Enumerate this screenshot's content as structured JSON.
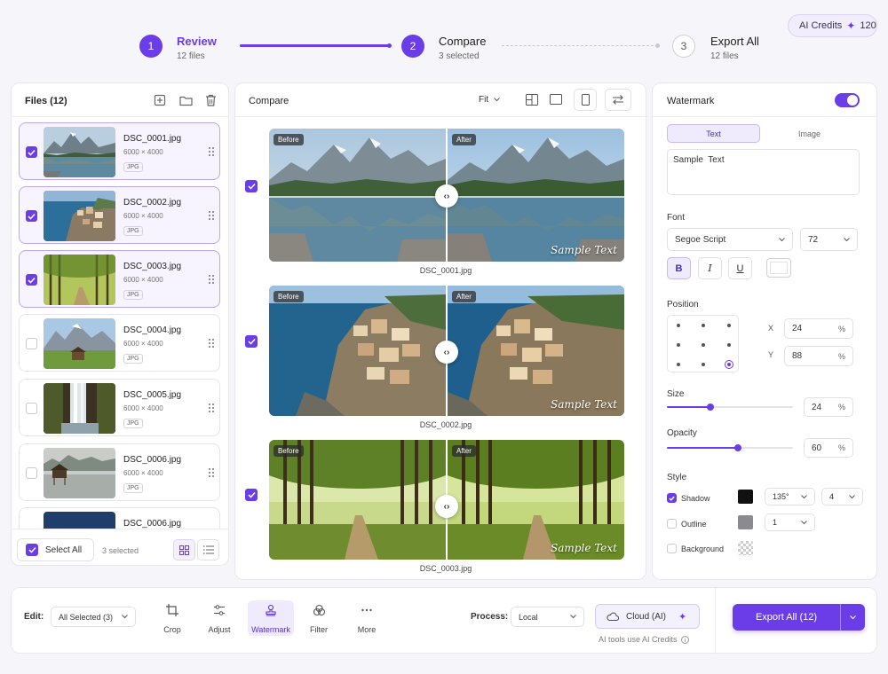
{
  "credits": {
    "label": "AI Credits",
    "amount": "120"
  },
  "steps": [
    {
      "number": "1",
      "title": "Review",
      "sub": "12 files"
    },
    {
      "number": "2",
      "title": "Compare",
      "sub": "3 selected"
    },
    {
      "number": "3",
      "title": "Export All",
      "sub": "12 files"
    }
  ],
  "files_panel": {
    "title": "Files (12)",
    "files": [
      {
        "name": "DSC_0001.jpg",
        "dims": "6000 × 4000",
        "type": "JPG",
        "checked": true
      },
      {
        "name": "DSC_0002.jpg",
        "dims": "6000 × 4000",
        "type": "JPG",
        "checked": true
      },
      {
        "name": "DSC_0003.jpg",
        "dims": "6000 × 4000",
        "type": "JPG",
        "checked": true
      },
      {
        "name": "DSC_0004.jpg",
        "dims": "6000 × 4000",
        "type": "JPG",
        "checked": false
      },
      {
        "name": "DSC_0005.jpg",
        "dims": "6000 × 4000",
        "type": "JPG",
        "checked": false
      },
      {
        "name": "DSC_0006.jpg",
        "dims": "6000 × 4000",
        "type": "JPG",
        "checked": false
      },
      {
        "name": "DSC_0006.jpg",
        "dims": "",
        "type": "",
        "checked": false
      }
    ],
    "select_all": "Select All",
    "selected_count": "3 selected"
  },
  "compare": {
    "title": "Compare",
    "fit": "Fit",
    "before": "Before",
    "after": "After",
    "watermark_text": "Sample Text",
    "items": [
      {
        "caption": "DSC_0001.jpg"
      },
      {
        "caption": "DSC_0002.jpg"
      },
      {
        "caption": "DSC_0003.jpg"
      }
    ]
  },
  "watermark": {
    "title": "Watermark",
    "enabled": true,
    "tab_text": "Text",
    "tab_image": "Image",
    "text_value": "Sample  Text",
    "font_label": "Font",
    "font": "Segoe Script",
    "font_size": "72",
    "bold": "B",
    "italic": "I",
    "underline": "U",
    "position_label": "Position",
    "x_label": "X",
    "x_value": "24",
    "y_label": "Y",
    "y_value": "88",
    "percent": "%",
    "size_label": "Size",
    "size_value": "24",
    "opacity_label": "Opacity",
    "opacity_value": "60",
    "style_label": "Style",
    "shadow_label": "Shadow",
    "shadow_checked": true,
    "shadow_angle": "135°",
    "shadow_distance": "4",
    "outline_label": "Outline",
    "outline_checked": false,
    "outline_width": "1",
    "background_label": "Background",
    "background_checked": false
  },
  "bottom_bar": {
    "edit_label": "Edit:",
    "edit_scope": "All Selected (3)",
    "tools": [
      {
        "label": "Crop",
        "icon": "crop-icon"
      },
      {
        "label": "Adjust",
        "icon": "sliders-icon"
      },
      {
        "label": "Watermark",
        "icon": "stamp-icon"
      },
      {
        "label": "Filter",
        "icon": "filter-icon"
      },
      {
        "label": "More",
        "icon": "more-icon"
      }
    ],
    "active_tool": "Watermark",
    "process_label": "Process:",
    "process_value": "Local",
    "cloud_label": "Cloud (AI)",
    "ai_note": "AI tools use AI Credits",
    "export_label": "Export All (12)"
  },
  "colors": {
    "accent": "#6a3de8",
    "accent_light": "#efebfd"
  }
}
